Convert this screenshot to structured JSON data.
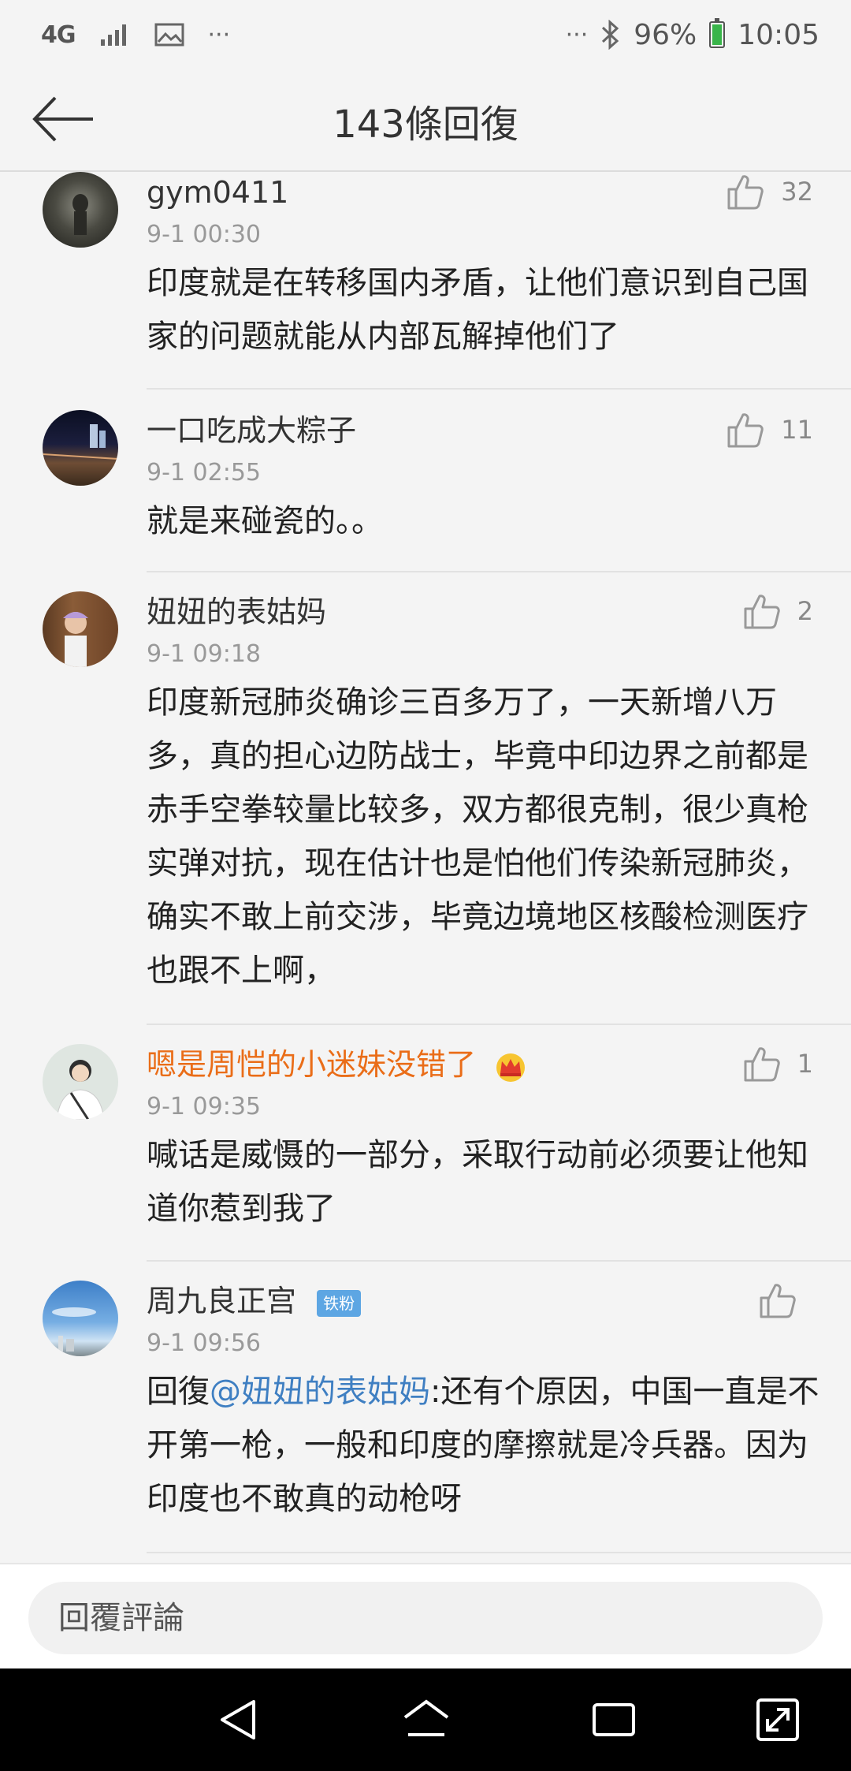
{
  "status_bar": {
    "network": "4G",
    "dots_left": "···",
    "dots_right": "···",
    "battery": "96%",
    "time": "10:05"
  },
  "header": {
    "title": "143條回復"
  },
  "comments": [
    {
      "username": "gym0411",
      "time": "9-1 00:30",
      "likes": "32",
      "text": "印度就是在转移国内矛盾，让他们意识到自己国家的问题就能从内部瓦解掉他们了"
    },
    {
      "username": "一口吃成大粽子",
      "time": "9-1 02:55",
      "likes": "11",
      "text": "就是来碰瓷的。。"
    },
    {
      "username": "妞妞的表姑妈",
      "time": "9-1 09:18",
      "likes": "2",
      "text": "印度新冠肺炎确诊三百多万了，一天新增八万多，真的担心边防战士，毕竟中印边界之前都是赤手空拳较量比较多，双方都很克制，很少真枪实弹对抗，现在估计也是怕他们传染新冠肺炎，确实不敢上前交涉，毕竟边境地区核酸检测医疗也跟不上啊，"
    },
    {
      "username": "嗯是周恺的小迷妹没错了",
      "time": "9-1 09:35",
      "likes": "1",
      "text": "喊话是威慑的一部分，采取行动前必须要让他知道你惹到我了"
    },
    {
      "username": "周九良正宫",
      "badge": "铁粉",
      "time": "9-1 09:56",
      "likes": "",
      "reply_prefix": "回復",
      "mention": "@妞妞的表姑妈",
      "text": ":还有个原因，中国一直是不开第一枪，一般和印度的摩擦就是冷兵器。因为印度也不敢真的动枪呀"
    }
  ],
  "input": {
    "placeholder": "回覆評論"
  },
  "icons": {
    "back": "arrow-left-icon",
    "like": "thumbs-up-icon",
    "crown": "crown-icon",
    "nav": [
      "back-triangle-icon",
      "home-icon",
      "recents-icon",
      "expand-icon"
    ]
  },
  "colors": {
    "highlight_name": "#ea6d18",
    "mention": "#3f7fc2",
    "badge": "#5da6e3"
  }
}
